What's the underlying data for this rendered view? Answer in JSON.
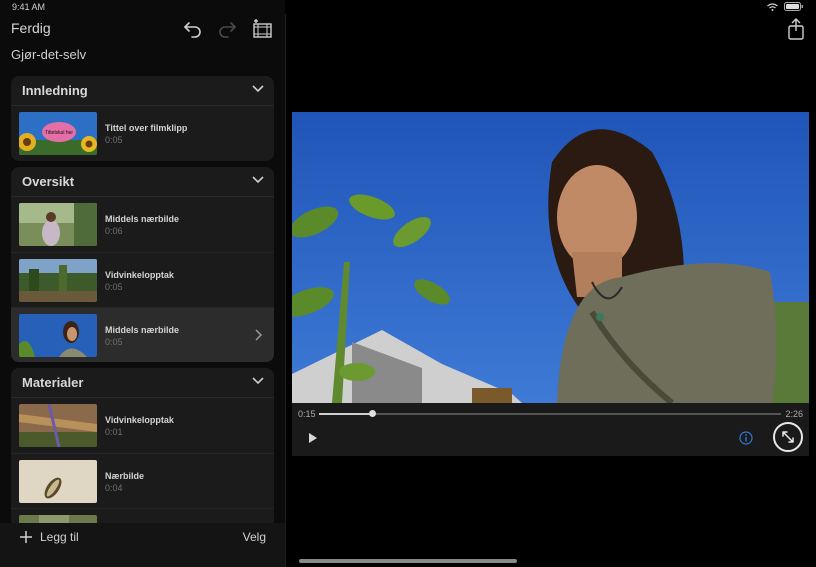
{
  "status": {
    "time": "9:41 AM"
  },
  "topbar": {
    "done_label": "Ferdig"
  },
  "page_title": "Gjør-det-selv",
  "sections": [
    {
      "title": "Innledning",
      "clips": [
        {
          "name": "Tittel over filmklipp",
          "duration": "0:05",
          "thumb_text": "Tittelskal her"
        }
      ]
    },
    {
      "title": "Oversikt",
      "clips": [
        {
          "name": "Middels nærbilde",
          "duration": "0:06"
        },
        {
          "name": "Vidvinkelopptak",
          "duration": "0:05"
        },
        {
          "name": "Middels nærbilde",
          "duration": "0:05"
        }
      ]
    },
    {
      "title": "Materialer",
      "clips": [
        {
          "name": "Vidvinkelopptak",
          "duration": "0:01"
        },
        {
          "name": "Nærbilde",
          "duration": "0:04"
        }
      ]
    }
  ],
  "bottombar": {
    "add_label": "Legg til",
    "select_label": "Velg"
  },
  "player": {
    "current_time": "0:15",
    "total_time": "2:26",
    "progress": 0.115
  },
  "colors": {
    "accent": "#2f7bd6",
    "background": "#000000",
    "panel": "#1b1b1b",
    "selected_row": "#2c2c2c"
  },
  "icons": [
    "undo-icon",
    "redo-icon",
    "add-clip-icon",
    "share-icon",
    "chevron-down-icon",
    "chevron-right-icon",
    "plus-icon",
    "play-icon",
    "info-icon",
    "expand-icon",
    "wifi-icon",
    "battery-icon"
  ]
}
